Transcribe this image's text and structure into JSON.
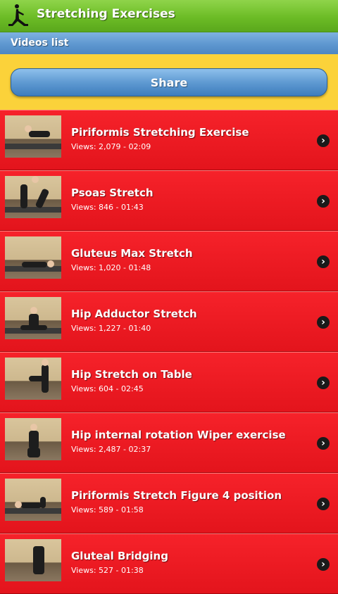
{
  "header": {
    "title": "Stretching Exercises",
    "icon": "yoga-pose-icon"
  },
  "section": {
    "title": "Videos list"
  },
  "share": {
    "label": "Share"
  },
  "colors": {
    "header_green": "#6cbc26",
    "section_blue": "#5e97d0",
    "share_area_yellow": "#fbd23a",
    "list_red": "#e3141c"
  },
  "videos": [
    {
      "title": "Piriformis Stretching Exercise",
      "meta": "Views: 2,079 - 02:09"
    },
    {
      "title": "Psoas Stretch",
      "meta": "Views: 846 - 01:43"
    },
    {
      "title": "Gluteus Max Stretch",
      "meta": "Views: 1,020 - 01:48"
    },
    {
      "title": "Hip Adductor Stretch",
      "meta": "Views: 1,227 - 01:40"
    },
    {
      "title": "Hip Stretch on Table",
      "meta": "Views: 604 - 02:45"
    },
    {
      "title": "Hip internal rotation Wiper exercise",
      "meta": "Views: 2,487 - 02:37"
    },
    {
      "title": "Piriformis Stretch Figure 4 position",
      "meta": "Views: 589 - 01:58"
    },
    {
      "title": "Gluteal Bridging",
      "meta": "Views: 527 - 01:38"
    }
  ]
}
